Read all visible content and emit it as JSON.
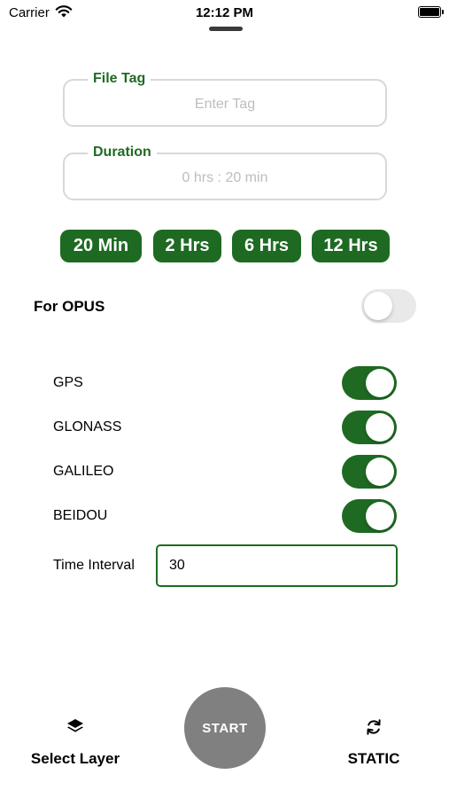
{
  "status_bar": {
    "carrier": "Carrier",
    "time": "12:12 PM"
  },
  "form": {
    "file_tag": {
      "label": "File Tag",
      "placeholder": "Enter Tag",
      "value": ""
    },
    "duration": {
      "label": "Duration",
      "placeholder": "0 hrs : 20 min",
      "value": ""
    }
  },
  "duration_presets": [
    "20 Min",
    "2 Hrs",
    "6 Hrs",
    "12 Hrs"
  ],
  "opus": {
    "label": "For OPUS",
    "enabled": false
  },
  "constellations": [
    {
      "label": "GPS",
      "enabled": true
    },
    {
      "label": "GLONASS",
      "enabled": true
    },
    {
      "label": "GALILEO",
      "enabled": true
    },
    {
      "label": "BEIDOU",
      "enabled": true
    }
  ],
  "time_interval": {
    "label": "Time Interval",
    "value": "30"
  },
  "bottom_bar": {
    "select_layer": {
      "label": "Select Layer",
      "icon": "layers-icon"
    },
    "start": {
      "label": "START"
    },
    "mode": {
      "label": "STATIC",
      "icon": "refresh-icon"
    }
  },
  "colors": {
    "accent": "#1e6a22",
    "start_button": "#808080",
    "toggle_off": "#e9e9ea"
  }
}
